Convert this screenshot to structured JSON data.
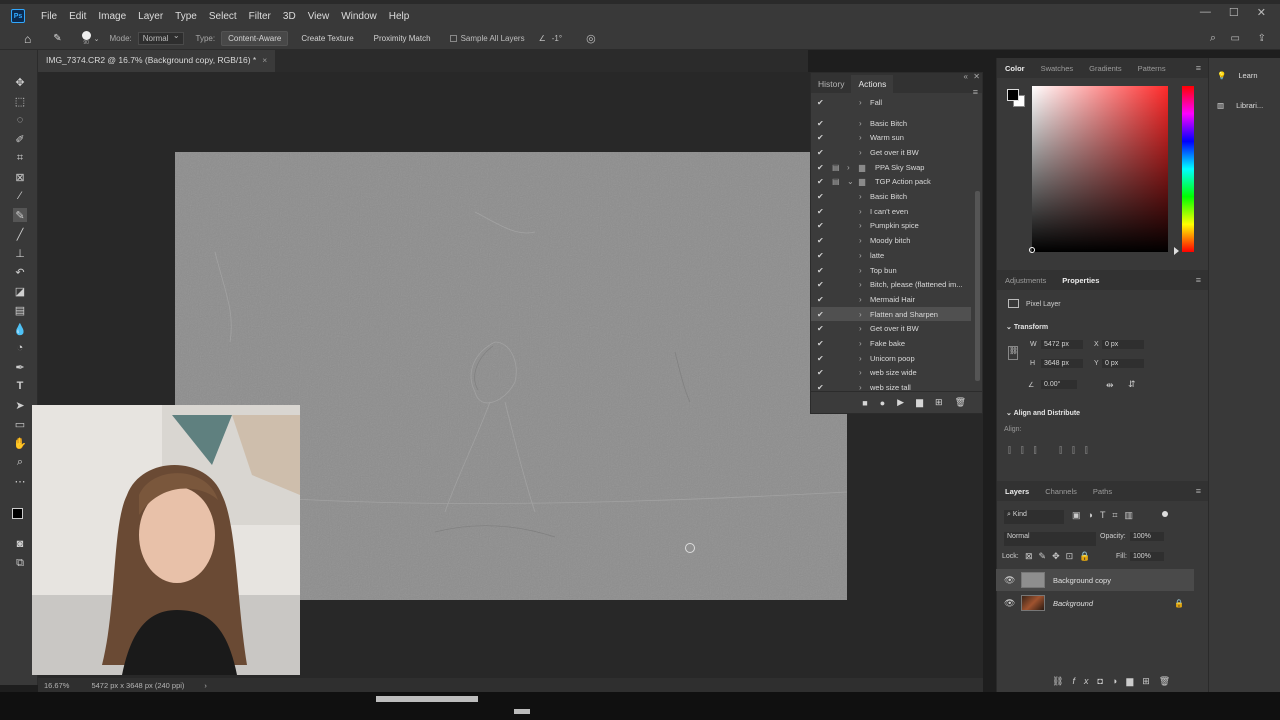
{
  "app": {
    "logo_text": "Ps"
  },
  "menu": [
    "File",
    "Edit",
    "Image",
    "Layer",
    "Type",
    "Select",
    "Filter",
    "3D",
    "View",
    "Window",
    "Help"
  ],
  "options": {
    "brush_size": "90",
    "mode_label": "Mode:",
    "mode_value": "Normal",
    "type_label": "Type:",
    "type_buttons": [
      "Content-Aware",
      "Create Texture",
      "Proximity Match"
    ],
    "sample_all_layers": "Sample All Layers",
    "angle": "-1°"
  },
  "document": {
    "tab_title": "IMG_7374.CR2 @ 16.7% (Background copy, RGB/16) *",
    "tab_close": "×"
  },
  "status": {
    "zoom": "16.67%",
    "size_info": "5472 px x 3648 px (240 ppi)",
    "arrow": "›"
  },
  "actions_panel": {
    "tabs": [
      "History",
      "Actions"
    ],
    "active_tab": "Actions",
    "items": [
      {
        "label": "Fall",
        "kind": "action"
      },
      {
        "label": "Basic Bitch",
        "kind": "action"
      },
      {
        "label": "Warm sun",
        "kind": "action"
      },
      {
        "label": "Get over it BW",
        "kind": "action"
      },
      {
        "label": "PPA Sky Swap",
        "kind": "set"
      },
      {
        "label": "TGP Action pack",
        "kind": "set-open"
      },
      {
        "label": "Basic Bitch",
        "kind": "action"
      },
      {
        "label": "I can't even",
        "kind": "action"
      },
      {
        "label": "Pumpkin spice",
        "kind": "action"
      },
      {
        "label": "Moody bitch",
        "kind": "action"
      },
      {
        "label": "latte",
        "kind": "action"
      },
      {
        "label": "Top bun",
        "kind": "action"
      },
      {
        "label": "Bitch, please (flattened im...",
        "kind": "action"
      },
      {
        "label": "Mermaid Hair",
        "kind": "action"
      },
      {
        "label": "Flatten and Sharpen",
        "kind": "action",
        "selected": true
      },
      {
        "label": "Get over it BW",
        "kind": "action"
      },
      {
        "label": "Fake bake",
        "kind": "action"
      },
      {
        "label": "Unicorn  poop",
        "kind": "action"
      },
      {
        "label": "web size wide",
        "kind": "action"
      },
      {
        "label": "web size tall",
        "kind": "action"
      }
    ]
  },
  "color_panel": {
    "tabs": [
      "Color",
      "Swatches",
      "Gradients",
      "Patterns"
    ],
    "active_tab": "Color",
    "foreground": "#000000",
    "background": "#ffffff"
  },
  "properties_panel": {
    "tabs": [
      "Adjustments",
      "Properties"
    ],
    "active_tab": "Properties",
    "layer_type": "Pixel Layer",
    "transform_title": "Transform",
    "w_label": "W",
    "w_value": "5472 px",
    "h_label": "H",
    "h_value": "3648 px",
    "x_label": "X",
    "x_value": "0 px",
    "y_label": "Y",
    "y_value": "0 px",
    "angle_value": "0.00°",
    "align_title": "Align and Distribute",
    "align_label": "Align:"
  },
  "layers_panel": {
    "tabs": [
      "Layers",
      "Channels",
      "Paths"
    ],
    "active_tab": "Layers",
    "filter_kind": "Kind",
    "blend_mode": "Normal",
    "opacity_label": "Opacity:",
    "opacity_value": "100%",
    "lock_label": "Lock:",
    "fill_label": "Fill:",
    "fill_value": "100%",
    "layers": [
      {
        "name": "Background copy",
        "selected": true
      },
      {
        "name": "Background",
        "locked": true
      }
    ]
  },
  "side_panel": {
    "items": [
      "Learn",
      "Librari..."
    ]
  }
}
